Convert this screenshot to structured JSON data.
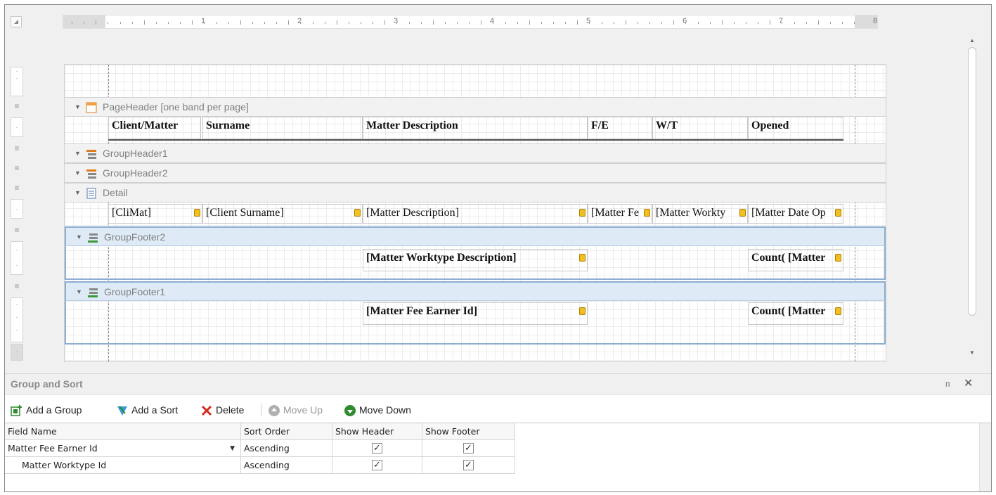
{
  "ruler": {
    "numbers": [
      "1",
      "2",
      "3",
      "4",
      "5",
      "6",
      "7",
      "8"
    ]
  },
  "bands": {
    "page_header": "PageHeader [one band per page]",
    "group_header1": "GroupHeader1",
    "group_header2": "GroupHeader2",
    "detail": "Detail",
    "group_footer2": "GroupFooter2",
    "group_footer1": "GroupFooter1"
  },
  "page_header_cells": {
    "client_matter": "Client/Matter",
    "surname": "Surname",
    "matter_description": "Matter Description",
    "fe": "F/E",
    "wt": "W/T",
    "opened": "Opened"
  },
  "detail_cells": {
    "climat": "[CliMat]",
    "client_surname": "[Client Surname]",
    "matter_description": "[Matter Description]",
    "matter_fe": "[Matter Fe",
    "matter_worktype": "[Matter Workty",
    "matter_date": "[Matter Date Op"
  },
  "footer2_cells": {
    "worktype_desc": "[Matter Worktype Description]",
    "count": "Count( [Matter"
  },
  "footer1_cells": {
    "fee_earner": "[Matter Fee Earner Id]",
    "count": "Count( [Matter"
  },
  "group_sort": {
    "title": "Group and Sort",
    "pin_glyph": "ᴨ",
    "close_glyph": "✕",
    "toolbar": {
      "add_group": "Add a Group",
      "add_sort": "Add a Sort",
      "delete": "Delete",
      "move_up": "Move Up",
      "move_down": "Move Down"
    },
    "columns": [
      "Field Name",
      "Sort Order",
      "Show Header",
      "Show Footer"
    ],
    "rows": [
      {
        "field": "Matter Fee Earner Id",
        "order": "Ascending",
        "header": "✓",
        "footer": "✓"
      },
      {
        "field": "Matter Worktype Id",
        "order": "Ascending",
        "header": "✓",
        "footer": "✓"
      }
    ]
  },
  "colors": {
    "selection_border": "#8eaed1",
    "selection_fill": "#deebf7",
    "accent_green": "#2e8b2e",
    "delete_red": "#d62b1f"
  }
}
